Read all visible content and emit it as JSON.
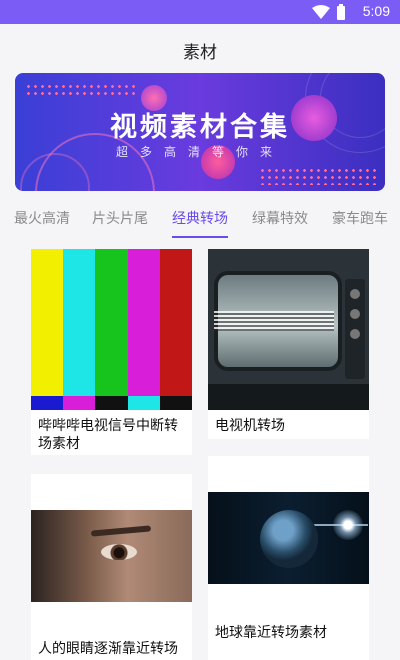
{
  "status_bar": {
    "time": "5:09",
    "icons": [
      "wifi-icon",
      "battery-icon"
    ],
    "color": "#7b5cf5"
  },
  "header": {
    "title": "素材"
  },
  "banner": {
    "headline": "视频素材合集",
    "subtitle": "超多高清等你来"
  },
  "tabs": [
    {
      "label": "最火高清",
      "active": false
    },
    {
      "label": "片头片尾",
      "active": false
    },
    {
      "label": "经典转场",
      "active": true
    },
    {
      "label": "绿幕特效",
      "active": false
    },
    {
      "label": "豪车跑车",
      "active": false
    }
  ],
  "accent_color": "#6a4ce8",
  "cards": [
    {
      "caption": "哔哔哔电视信号中断转场素材",
      "thumbnail": "color-bars-test-pattern"
    },
    {
      "caption": "电视机转场",
      "thumbnail": "old-television"
    },
    {
      "caption": "人的眼睛逐渐靠近转场",
      "thumbnail": "human-eye-closeup"
    },
    {
      "caption": "地球靠近转场素材",
      "thumbnail": "earth-from-space"
    }
  ]
}
